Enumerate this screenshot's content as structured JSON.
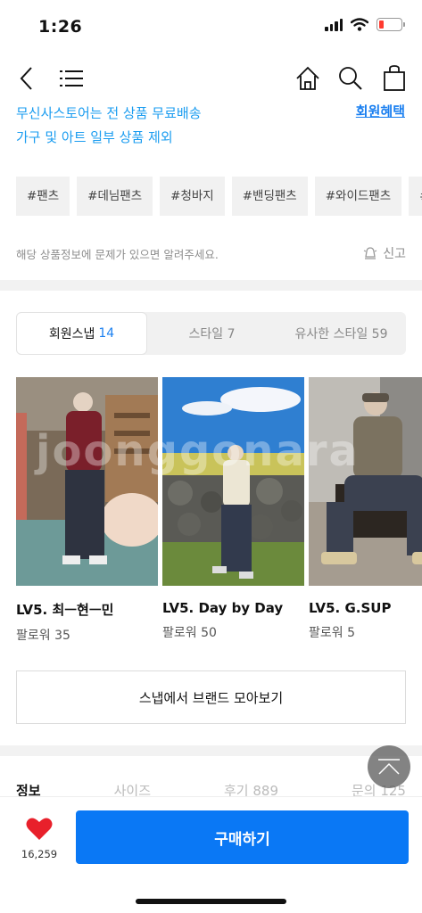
{
  "status": {
    "time": "1:26"
  },
  "promo": {
    "line1": "무신사스토어는 전 상품 무료배송",
    "line2": "가구 및 아트 일부 상품 제외",
    "benefit_link": "회원혜택"
  },
  "hashtags": [
    "#팬츠",
    "#데님팬츠",
    "#청바지",
    "#밴딩팬츠",
    "#와이드팬츠",
    "#빅"
  ],
  "report": {
    "message": "해당 상품정보에 문제가 있으면 알려주세요.",
    "button": "신고"
  },
  "snap_tabs": [
    {
      "label": "회원스냅",
      "count": "14"
    },
    {
      "label": "스타일 7",
      "count": ""
    },
    {
      "label": "유사한 스타일 59",
      "count": ""
    }
  ],
  "snaps": [
    {
      "name": "LV5. 최ㅡ현ㅡ민",
      "followers": "팔로워 35"
    },
    {
      "name": "LV5. Day by Day",
      "followers": "팔로워 50"
    },
    {
      "name": "LV5. G.SUP",
      "followers": "팔로워 5"
    }
  ],
  "watermark": "joonggonara",
  "snap_more": "스냅에서 브랜드 모아보기",
  "info_tabs": [
    "정보",
    "사이즈",
    "후기 889",
    "문의 125"
  ],
  "like": {
    "count": "16,259"
  },
  "buy_button": "구매하기",
  "colors": {
    "accent_blue": "#0a78f5",
    "link_blue": "#1a9cf0",
    "heart_red": "#e8202b"
  }
}
